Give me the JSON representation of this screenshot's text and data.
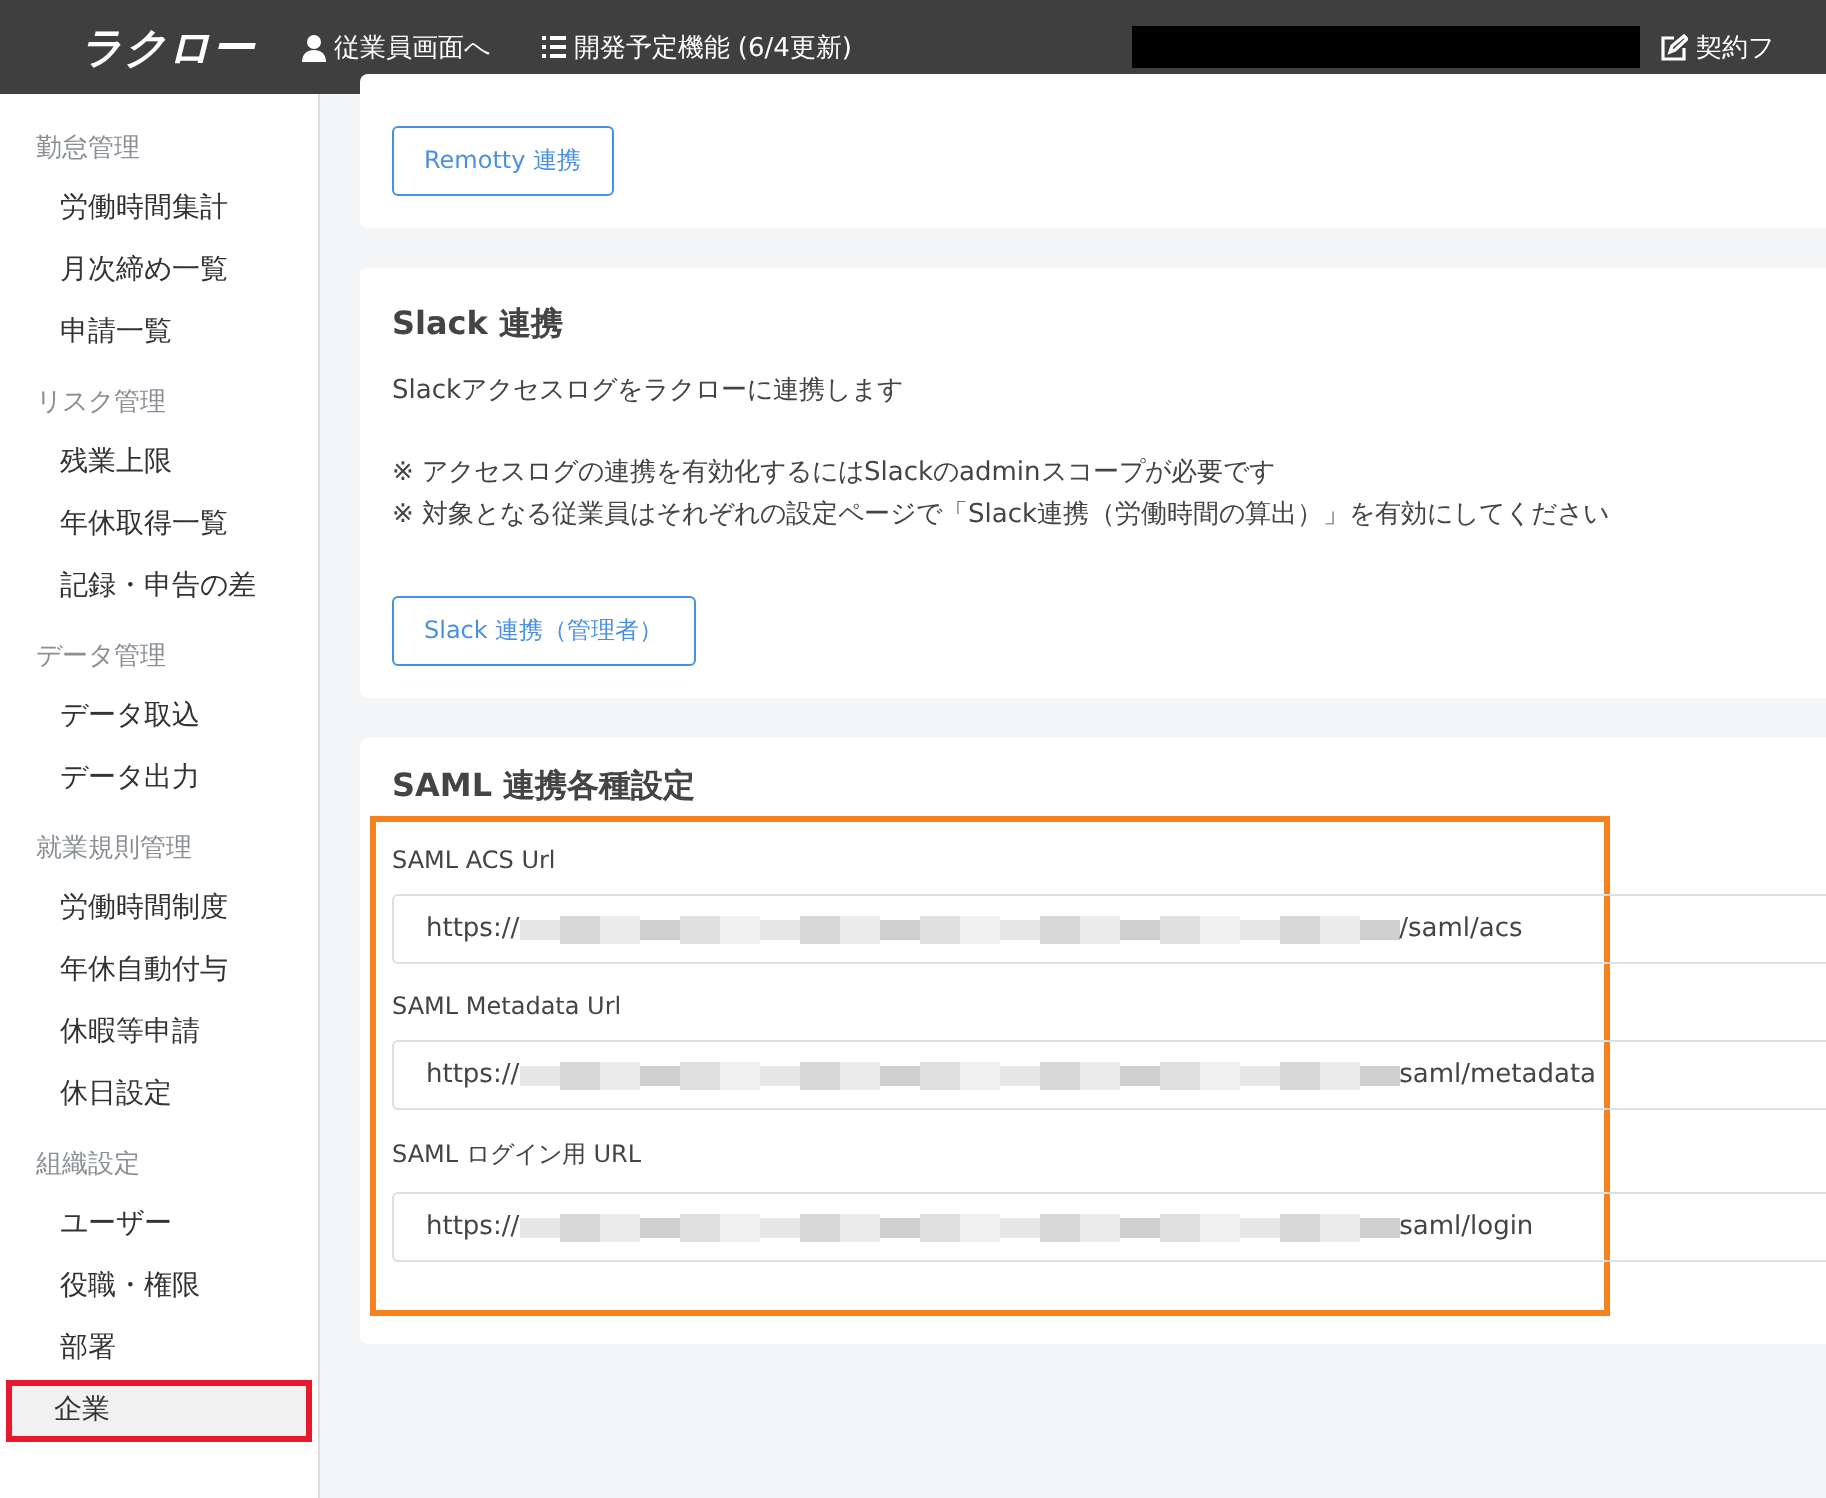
{
  "topbar": {
    "logo": "ラクロー",
    "links": [
      {
        "kind": "user",
        "label": "従業員画面へ"
      },
      {
        "kind": "list",
        "label": "開発予定機能 (6/4更新)"
      },
      {
        "kind": "edit",
        "label": "契約フ"
      }
    ]
  },
  "sidebar": {
    "groups": [
      {
        "heading": "勤怠管理",
        "items": [
          {
            "label": "労働時間集計",
            "selected": false
          },
          {
            "label": "月次締め一覧",
            "selected": false
          },
          {
            "label": "申請一覧",
            "selected": false
          }
        ]
      },
      {
        "heading": "リスク管理",
        "items": [
          {
            "label": "残業上限",
            "selected": false
          },
          {
            "label": "年休取得一覧",
            "selected": false
          },
          {
            "label": "記録・申告の差",
            "selected": false
          }
        ]
      },
      {
        "heading": "データ管理",
        "items": [
          {
            "label": "データ取込",
            "selected": false
          },
          {
            "label": "データ出力",
            "selected": false
          }
        ]
      },
      {
        "heading": "就業規則管理",
        "items": [
          {
            "label": "労働時間制度",
            "selected": false
          },
          {
            "label": "年休自動付与",
            "selected": false
          },
          {
            "label": "休暇等申請",
            "selected": false
          },
          {
            "label": "休日設定",
            "selected": false
          }
        ]
      },
      {
        "heading": "組織設定",
        "items": [
          {
            "label": "ユーザー",
            "selected": false
          },
          {
            "label": "役職・権限",
            "selected": false
          },
          {
            "label": "部署",
            "selected": false
          },
          {
            "label": "企業",
            "selected": true
          }
        ]
      }
    ]
  },
  "cards": [
    {
      "kind": "button_only",
      "button": "Remotty 連携"
    },
    {
      "kind": "integration",
      "title": "Slack 連携",
      "description": "Slackアクセスログをラクローに連携します",
      "notes": [
        "※ アクセスログの連携を有効化するにはSlackのadminスコープが必要です",
        "※ 対象となる従業員はそれぞれの設定ページで「Slack連携（労働時間の算出）」を有効にしてください"
      ],
      "button": "Slack 連携（管理者）"
    },
    {
      "kind": "fields",
      "title": "SAML 連携各種設定",
      "fields": [
        {
          "label": "SAML ACS Url",
          "value_start": "https://",
          "value_end": "/saml/acs"
        },
        {
          "label": "SAML Metadata Url",
          "value_start": "https://",
          "value_end": "saml/metadata"
        },
        {
          "label": "SAML ログイン用 URL",
          "value_start": "https://",
          "value_end": "saml/login"
        }
      ]
    }
  ]
}
